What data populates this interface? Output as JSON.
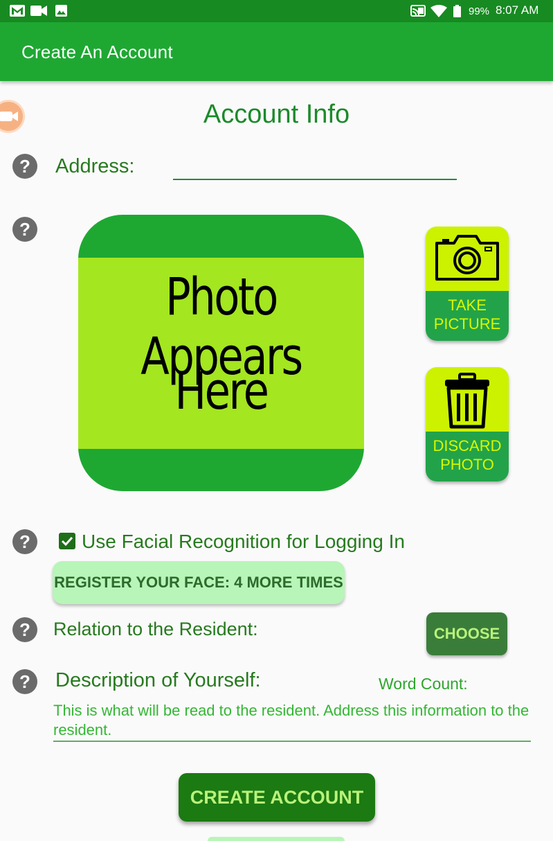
{
  "status_bar": {
    "battery": "99%",
    "time": "8:07 AM",
    "icons": [
      "gmail-icon",
      "video-icon",
      "image-icon",
      "cast-icon",
      "wifi-icon",
      "battery-icon"
    ]
  },
  "app_bar": {
    "title": "Create An Account"
  },
  "section_title": "Account Info",
  "address": {
    "label": "Address:",
    "value": ""
  },
  "photo": {
    "placeholder_line1": "Photo Appears",
    "placeholder_line2": "Here"
  },
  "take_picture": {
    "label_line1": "TAKE",
    "label_line2": "PICTURE"
  },
  "discard_photo": {
    "label_line1": "DISCARD",
    "label_line2": "PHOTO"
  },
  "facial": {
    "label": "Use Facial Recognition for Logging In",
    "checked": true,
    "register_label": "REGISTER YOUR FACE: 4 MORE TIMES"
  },
  "relation": {
    "label": "Relation to the Resident:",
    "choose_label": "CHOOSE"
  },
  "description": {
    "label": "Description of Yourself:",
    "word_count_label": "Word Count:",
    "placeholder": "This is what will be read to the resident. Address this information to the resident."
  },
  "create_account_label": "CREATE ACCOUNT",
  "colors": {
    "status_bar": "#188a22",
    "app_bar": "#1ea832",
    "accent_lime": "#ccf200",
    "text_green": "#277a1f",
    "create_button": "#1b7a12"
  }
}
